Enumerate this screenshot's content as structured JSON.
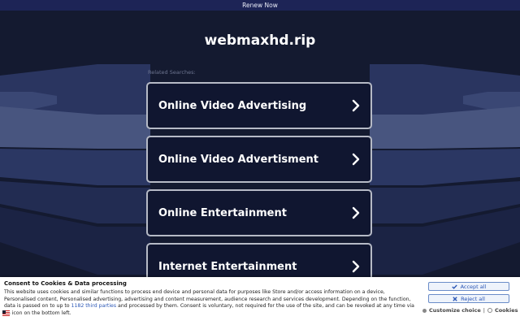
{
  "topbar": {
    "label": "Renew Now"
  },
  "site": {
    "domain": "webmaxhd.rip"
  },
  "related_label": "Related Searches:",
  "cards": [
    {
      "label": "Online Video Advertising"
    },
    {
      "label": "Online Video Advertisment"
    },
    {
      "label": "Online Entertainment"
    },
    {
      "label": "Internet Entertainment"
    }
  ],
  "consent": {
    "title": "Consent to Cookies & Data processing",
    "body_part1": "This website uses cookies and similar functions to process end device and personal data for purposes like Store and/or access information on a device, Personalised content, Personalised advertising, advertising and content measurement, audience research and services development. Depending on the function, data is passed on to up to ",
    "link": "1182 third parties",
    "body_part2": " and processed by them. Consent is voluntary, not required for the use of the site, and can be revoked at any time via an icon on the bottom left.",
    "accept_label": "Accept all",
    "reject_label": "Reject all",
    "customize_label": "Customize choice",
    "separator": "|",
    "cookies_label": "Cookies"
  },
  "colors": {
    "background": "#141a30",
    "topbar": "#1d2456",
    "card_border": "#b6bac6",
    "link": "#2a56b5"
  }
}
